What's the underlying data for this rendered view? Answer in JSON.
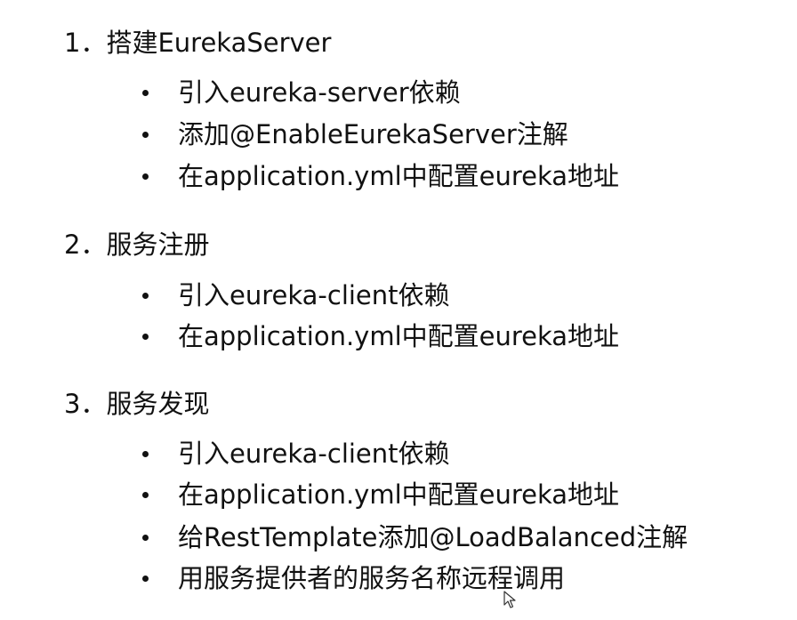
{
  "sections": [
    {
      "title": "1．搭建EurekaServer",
      "items": [
        "引入eureka-server依赖",
        "添加@EnableEurekaServer注解",
        "在application.yml中配置eureka地址"
      ]
    },
    {
      "title": "2．服务注册",
      "items": [
        "引入eureka-client依赖",
        "在application.yml中配置eureka地址"
      ]
    },
    {
      "title": "3．服务发现",
      "items": [
        "引入eureka-client依赖",
        "在application.yml中配置eureka地址",
        "给RestTemplate添加@LoadBalanced注解",
        "用服务提供者的服务名称远程调用"
      ]
    }
  ],
  "cursor": {
    "icon": "mouse-pointer-icon"
  }
}
